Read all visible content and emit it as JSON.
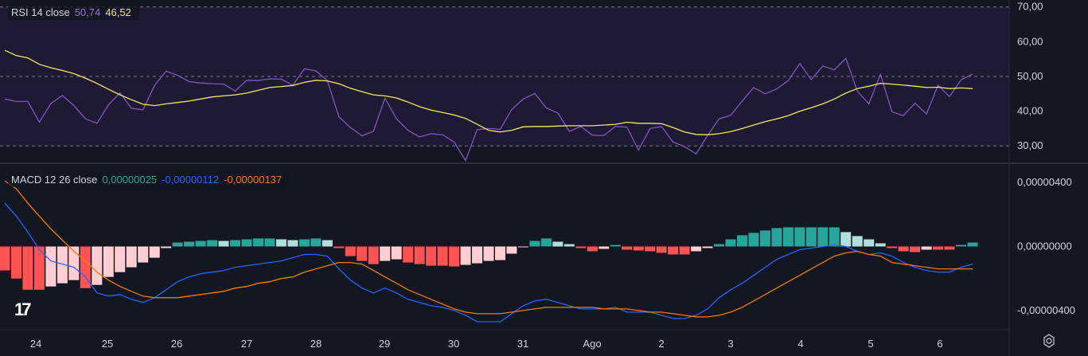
{
  "rsi_legend": {
    "title": "RSI 14 close",
    "rsi_value": "50,74",
    "ma_value": "46,52",
    "rsi_color": "#7e57c2",
    "ma_color": "#f5e663"
  },
  "macd_legend": {
    "title": "MACD 12 26 close",
    "hist_value": "0,00000025",
    "macd_value": "-0,00000112",
    "signal_value": "-0,00000137",
    "hist_color": "#26a69a",
    "macd_color": "#2962ff",
    "signal_color": "#f57c00"
  },
  "icons": {
    "logo": "tradingview-logo-icon",
    "settings": "gear-icon"
  },
  "chart_data": [
    {
      "type": "line",
      "title": "RSI 14 close",
      "ylim": [
        25,
        72
      ],
      "y_ticks": [
        "70,00",
        "60,00",
        "50,00",
        "40,00",
        "30,00"
      ],
      "y_tick_values": [
        70,
        60,
        50,
        40,
        30
      ],
      "bands": [
        70,
        50,
        30
      ],
      "x_tick_labels": [
        "24",
        "25",
        "26",
        "27",
        "28",
        "29",
        "30",
        "31",
        "Ago",
        "2",
        "3",
        "4",
        "5",
        "6"
      ],
      "series": [
        {
          "color": "#7e57c2",
          "values": [
            43.5,
            42.8,
            42.8,
            36.8,
            42.2,
            44.5,
            41.6,
            37.8,
            36.5,
            41.8,
            45.3,
            40.8,
            40.4,
            47.4,
            51.5,
            50.3,
            48.5,
            48.1,
            47.9,
            47.8,
            45.8,
            48.9,
            48.8,
            49.3,
            49.2,
            47.5,
            52.2,
            51.6,
            48.8,
            38.4,
            35.3,
            32.9,
            34.2,
            43.7,
            37.8,
            34.5,
            32.6,
            33.5,
            33.2,
            31.1,
            25.8,
            34.7,
            35.0,
            34.8,
            40.5,
            43.5,
            45.1,
            40.9,
            39.5,
            34.2,
            35.6,
            33.1,
            33.0,
            35.6,
            35.4,
            28.8,
            35.0,
            35.6,
            31.1,
            29.8,
            27.7,
            33.0,
            37.8,
            38.8,
            42.9,
            46.8,
            45.0,
            46.4,
            48.8,
            53.7,
            49.1,
            53.0,
            51.9,
            55.2,
            45.7,
            42.1,
            50.6,
            39.8,
            38.7,
            42.3,
            39.2,
            47.5,
            44.2,
            49.0,
            50.7
          ]
        },
        {
          "color": "#f5e663",
          "values": [
            57.5,
            56.0,
            55.3,
            53.5,
            52.5,
            51.7,
            50.8,
            49.5,
            48.0,
            46.3,
            44.7,
            43.3,
            42.0,
            41.6,
            42.1,
            42.5,
            42.9,
            43.5,
            44.1,
            44.4,
            44.7,
            45.2,
            46.0,
            46.8,
            47.1,
            47.4,
            48.3,
            48.9,
            48.7,
            47.9,
            46.6,
            45.6,
            44.7,
            44.4,
            43.8,
            42.6,
            41.3,
            40.3,
            39.6,
            38.9,
            37.9,
            36.2,
            34.5,
            34.0,
            34.5,
            35.5,
            35.6,
            35.6,
            35.7,
            35.8,
            35.8,
            35.8,
            36.0,
            36.2,
            36.8,
            36.5,
            36.5,
            36.4,
            35.3,
            34.0,
            33.3,
            33.2,
            33.5,
            34.1,
            35.0,
            36.0,
            37.0,
            37.8,
            38.7,
            40.0,
            41.0,
            42.1,
            43.5,
            45.2,
            46.5,
            47.2,
            48.0,
            47.8,
            47.5,
            47.2,
            46.8,
            46.9,
            46.5,
            46.7,
            46.5
          ]
        }
      ]
    },
    {
      "type": "bar",
      "title": "MACD 12 26 close",
      "ylim": [
        -5.2e-06,
        5.1e-06
      ],
      "y_ticks": [
        "0,00000400",
        "0,00000000",
        "-0,00000400"
      ],
      "y_tick_values": [
        4e-06,
        0,
        -4e-06
      ],
      "x_tick_labels": [
        "24",
        "25",
        "26",
        "27",
        "28",
        "29",
        "30",
        "31",
        "Ago",
        "2",
        "3",
        "4",
        "5",
        "6"
      ],
      "histogram": [
        -1.5e-06,
        -2e-06,
        -2.7e-06,
        -2.7e-06,
        -2.5e-06,
        -2.3e-06,
        -2.1e-06,
        -2.6e-06,
        -2.4e-06,
        -1.9e-06,
        -1.6e-06,
        -1.3e-06,
        -1e-06,
        -7e-07,
        -1e-07,
        2.5e-07,
        3e-07,
        3.5e-07,
        4e-07,
        3.5e-07,
        4e-07,
        4.5e-07,
        5e-07,
        5e-07,
        4.5e-07,
        4e-07,
        4.5e-07,
        5e-07,
        4e-07,
        -1e-07,
        -6e-07,
        -9e-07,
        -1.1e-06,
        -9e-07,
        -8e-07,
        -1e-06,
        -1.1e-06,
        -1.2e-06,
        -1.2e-06,
        -1.25e-06,
        -1.15e-06,
        -1.05e-06,
        -9e-07,
        -8.5e-07,
        -4.5e-07,
        -5e-08,
        3.5e-07,
        5e-07,
        3e-07,
        1.5e-07,
        -1e-07,
        -3e-07,
        -1.5e-07,
        1e-07,
        -2e-07,
        -2.5e-07,
        -3e-07,
        -4e-07,
        -5e-07,
        -5e-07,
        -3e-07,
        -1e-07,
        1.5e-07,
        4.5e-07,
        7e-07,
        8.5e-07,
        1e-06,
        1.15e-06,
        1.2e-06,
        1.2e-06,
        1.2e-06,
        1.2e-06,
        1.2e-06,
        9e-07,
        6.5e-07,
        4.5e-07,
        2e-07,
        -1e-07,
        -3e-07,
        -3.5e-07,
        -2e-07,
        -2e-07,
        -2e-07,
        1e-07,
        2.5e-07
      ],
      "hist_colors": {
        "pos_up": "#26a69a",
        "pos_down": "#b2dfdb",
        "neg_down": "#ff5252",
        "neg_up": "#ffcdd2"
      },
      "series": [
        {
          "color": "#2962ff",
          "values": [
            2.7e-06,
            1.9e-06,
            9e-07,
            -2e-07,
            -9e-07,
            -1.1e-06,
            -1.3e-06,
            -1.9e-06,
            -2.9e-06,
            -3.1e-06,
            -3e-06,
            -3.3e-06,
            -3.5e-06,
            -3.2e-06,
            -2.7e-06,
            -2.2e-06,
            -1.9e-06,
            -1.7e-06,
            -1.6e-06,
            -1.5e-06,
            -1.3e-06,
            -1.2e-06,
            -1.1e-06,
            -1e-06,
            -9e-07,
            -7e-07,
            -5e-07,
            -5e-07,
            -6e-07,
            -1.4e-06,
            -2.1e-06,
            -2.6e-06,
            -2.9e-06,
            -2.6e-06,
            -2.9e-06,
            -3.3e-06,
            -3.5e-06,
            -3.7e-06,
            -3.8e-06,
            -4e-06,
            -4.3e-06,
            -4.7e-06,
            -4.7e-06,
            -4.7e-06,
            -4.2e-06,
            -3.7e-06,
            -3.4e-06,
            -3.3e-06,
            -3.5e-06,
            -3.7e-06,
            -3.9e-06,
            -3.9e-06,
            -3.9e-06,
            -3.8e-06,
            -4.1e-06,
            -4.1e-06,
            -4.1e-06,
            -4.3e-06,
            -4.5e-06,
            -4.5e-06,
            -4.3e-06,
            -3.9e-06,
            -3.2e-06,
            -2.7e-06,
            -2.3e-06,
            -1.8e-06,
            -1.3e-06,
            -8e-07,
            -5e-07,
            -2e-07,
            -1e-07,
            0.0,
            1e-07,
            0.0,
            -3e-07,
            -5e-07,
            -4e-07,
            -6e-07,
            -1e-06,
            -1.3e-06,
            -1.5e-06,
            -1.6e-06,
            -1.6e-06,
            -1.3e-06,
            -1.1e-06
          ]
        },
        {
          "color": "#f57c00",
          "values": [
            4.1e-06,
            3.6e-06,
            2.7e-06,
            1.9e-06,
            1.1e-06,
            4e-07,
            -3e-07,
            -9e-07,
            -1.6e-06,
            -2.1e-06,
            -2.5e-06,
            -2.8e-06,
            -3.1e-06,
            -3.2e-06,
            -3.2e-06,
            -3.2e-06,
            -3.1e-06,
            -3e-06,
            -2.9e-06,
            -2.8e-06,
            -2.6e-06,
            -2.5e-06,
            -2.3e-06,
            -2.2e-06,
            -2e-06,
            -1.9e-06,
            -1.6e-06,
            -1.4e-06,
            -1.2e-06,
            -1e-06,
            -1e-06,
            -1.1e-06,
            -1.5e-06,
            -1.9e-06,
            -2.3e-06,
            -2.7e-06,
            -3e-06,
            -3.3e-06,
            -3.6e-06,
            -3.9e-06,
            -4.1e-06,
            -4.2e-06,
            -4.2e-06,
            -4.2e-06,
            -4.1e-06,
            -4e-06,
            -3.9e-06,
            -3.8e-06,
            -3.8e-06,
            -3.8e-06,
            -3.8e-06,
            -3.8e-06,
            -3.9e-06,
            -3.9e-06,
            -3.9e-06,
            -4e-06,
            -4.1e-06,
            -4.1e-06,
            -4.2e-06,
            -4.3e-06,
            -4.4e-06,
            -4.4e-06,
            -4.3e-06,
            -4.1e-06,
            -3.8e-06,
            -3.4e-06,
            -3e-06,
            -2.6e-06,
            -2.2e-06,
            -1.8e-06,
            -1.4e-06,
            -1e-06,
            -6e-07,
            -4e-07,
            -3e-07,
            -5e-07,
            -6e-07,
            -1e-06,
            -1.1e-06,
            -1.2e-06,
            -1.3e-06,
            -1.4e-06,
            -1.4e-06,
            -1.4e-06,
            -1.4e-06
          ]
        }
      ]
    }
  ]
}
